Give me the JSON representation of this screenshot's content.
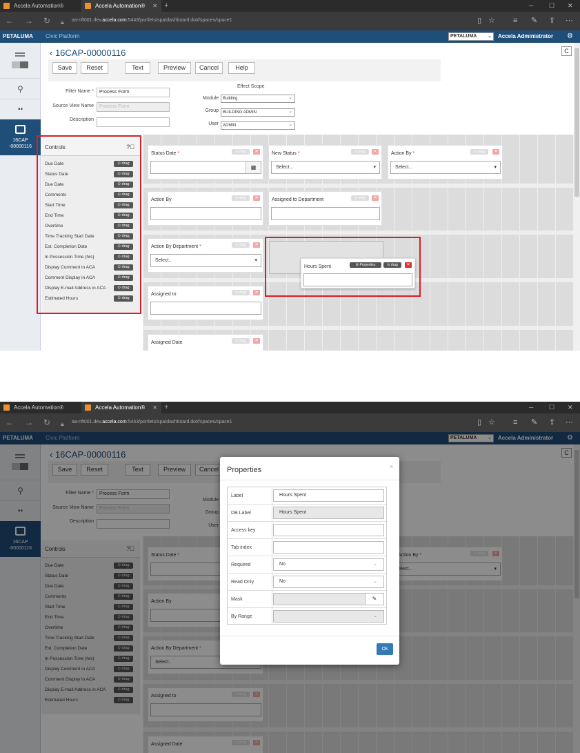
{
  "browser": {
    "tab1": "Accela Automation®",
    "tab2": "Accela Automation®",
    "tab_close": "✕",
    "new_tab": "+",
    "url_host": "aa-nft001.dev.",
    "url_domain": "accela.com",
    "url_path": ":5443/portlets/spa/dashboard.do#/spaces/space1"
  },
  "app": {
    "brand": "PETALUMA",
    "platform": "Civic Platform",
    "agency_select": "PETALUMA",
    "user": "Accela Administrator"
  },
  "sidebar": {
    "record_tab_line1": "16CAP",
    "record_tab_line2": "-00000116"
  },
  "record": {
    "title": "16CAP-00000116",
    "refresh": "C"
  },
  "toolbar": {
    "save": "Save",
    "reset": "Reset",
    "text": "Text",
    "preview": "Preview",
    "cancel": "Cancel",
    "help": "Help"
  },
  "filter": {
    "name_label": "Filter Name",
    "name_value": "Process Form",
    "source_label": "Source View Name",
    "source_value": "Process Form",
    "description_label": "Description",
    "description_value": ""
  },
  "effect_scope": {
    "title": "Effect Scope",
    "module_label": "Module",
    "module_value": "Building",
    "group_label": "Group",
    "group_value": "BUILDING ADMIN",
    "user_label": "User",
    "user_value": "ADMIN"
  },
  "controls": {
    "title": "Controls",
    "drag_label": "⊙ drag",
    "items": [
      "Due Date",
      "Status Date",
      "Due Date",
      "Comments",
      "Start Time",
      "End Time",
      "Overtime",
      "Time Tracking Start Date",
      "Est. Completion Date",
      "In Possession Time (hrs)",
      "Display Comment in ACA",
      "Comment Display in ACA",
      "Display E-mail Address in ACA",
      "Estimated Hours"
    ]
  },
  "form_fields": {
    "status_date": "Status Date",
    "new_status": "New Status",
    "action_by": "Action By",
    "action_by_plain": "Action By",
    "assigned_department": "Assigned to Department",
    "action_by_department": "Action By Department",
    "assigned_to": "Assigned to",
    "assigned_date": "Assigned Date",
    "hours_spent": "Hours Spent",
    "select_placeholder": "Select...",
    "select_placeholder_short": "Select..",
    "drag": "⊙ drag",
    "properties": "⚙ Properties",
    "remove": "✕",
    "required_mark": "*"
  },
  "properties_dialog": {
    "title": "Properties",
    "close": "×",
    "ok": "Ok",
    "rows": {
      "label": {
        "name": "Label",
        "value": "Hours Spent"
      },
      "db_label": {
        "name": "DB Label",
        "value": "Hours Spent"
      },
      "access_key": {
        "name": "Access key",
        "value": ""
      },
      "tab_index": {
        "name": "Tab index",
        "value": ""
      },
      "required": {
        "name": "Required",
        "value": "No"
      },
      "read_only": {
        "name": "Read Only",
        "value": "No"
      },
      "mask": {
        "name": "Mask",
        "value": ""
      },
      "by_range": {
        "name": "By Range",
        "value": ""
      }
    }
  },
  "colors": {
    "navbar": "#1f4e79",
    "highlight": "#e01b24",
    "ok_button": "#337ab7"
  }
}
